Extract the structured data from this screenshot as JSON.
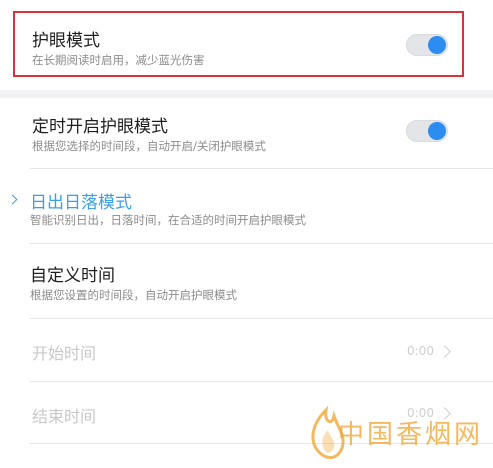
{
  "settings": {
    "eye_mode": {
      "title": "护眼模式",
      "subtitle": "在长期阅读时启用，减少蓝光伤害",
      "enabled": true
    },
    "timed_mode": {
      "title": "定时开启护眼模式",
      "subtitle": "根据您选择的时间段，自动开启/关闭护眼模式",
      "enabled": true
    },
    "sunrise_mode": {
      "title": "日出日落模式",
      "subtitle": "智能识别日出，日落时间，在合适的时间开启护眼模式"
    },
    "custom_time": {
      "title": "自定义时间",
      "subtitle": "根据您设置的时间段，自动开启护眼模式"
    },
    "start_time": {
      "label": "开始时间",
      "value": "0:00"
    },
    "end_time": {
      "label": "结束时间",
      "value": "0:00"
    }
  },
  "watermark": {
    "text": "中国香烟网"
  },
  "colors": {
    "accent": "#2d8cf0",
    "selected_text": "#3aa0e6",
    "highlight_border": "#d9323b"
  },
  "icons": {
    "toggle_knob": "circle",
    "chevron": "chevron-right-icon",
    "watermark_logo": "flame-icon"
  }
}
